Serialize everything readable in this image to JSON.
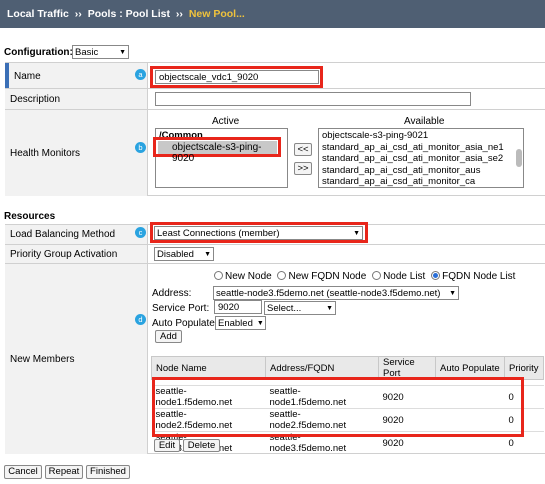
{
  "breadcrumb": {
    "part1": "Local Traffic",
    "sep": "››",
    "part2": "Pools : Pool List",
    "current": "New Pool..."
  },
  "configuration": {
    "label": "Configuration:",
    "mode": "Basic"
  },
  "name": {
    "label": "Name",
    "value": "objectscale_vdc1_9020",
    "badge": "a"
  },
  "description": {
    "label": "Description",
    "value": ""
  },
  "health": {
    "label": "Health Monitors",
    "badge": "b",
    "active_header": "Active",
    "available_header": "Available",
    "active_group": "/Common",
    "active_items": [
      "objectscale-s3-ping-9020"
    ],
    "available_items": [
      "objectscale-s3-ping-9021",
      "standard_ap_ai_csd_ati_monitor_asia_ne1",
      "standard_ap_ai_csd_ati_monitor_asia_se2",
      "standard_ap_ai_csd_ati_monitor_aus",
      "standard_ap_ai_csd_ati_monitor_ca"
    ],
    "move_left": "<<",
    "move_right": ">>"
  },
  "resources": {
    "title": "Resources"
  },
  "lb": {
    "label": "Load Balancing Method",
    "value": "Least Connections (member)",
    "badge": "c"
  },
  "pga": {
    "label": "Priority Group Activation",
    "value": "Disabled"
  },
  "members": {
    "label": "New Members",
    "badge": "d",
    "radios": [
      "New Node",
      "New FQDN Node",
      "Node List",
      "FQDN Node List"
    ],
    "address_label": "Address:",
    "address_value": "seattle-node3.f5demo.net (seattle-node3.f5demo.net)",
    "port_label": "Service Port:",
    "port_value": "9020",
    "port_select": "Select...",
    "autopop_label": "Auto Populate:",
    "autopop_value": "Enabled",
    "add": "Add",
    "columns": [
      "Node Name",
      "Address/FQDN",
      "Service Port",
      "Auto Populate",
      "Priority"
    ],
    "rows": [
      [
        "seattle-node1.f5demo.net",
        "seattle-node1.f5demo.net",
        "9020",
        "",
        "0"
      ],
      [
        "seattle-node2.f5demo.net",
        "seattle-node2.f5demo.net",
        "9020",
        "",
        "0"
      ],
      [
        "seattle-node3.f5demo.net",
        "seattle-node3.f5demo.net",
        "9020",
        "",
        "0"
      ]
    ],
    "edit": "Edit",
    "delete": "Delete"
  },
  "footer": {
    "cancel": "Cancel",
    "repeat": "Repeat",
    "finished": "Finished"
  },
  "colors": {
    "header_bg": "#4f5f73",
    "breadcrumb_current": "#f0c33c",
    "highlight": "#e8261b",
    "badge": "#2aa3e0"
  }
}
